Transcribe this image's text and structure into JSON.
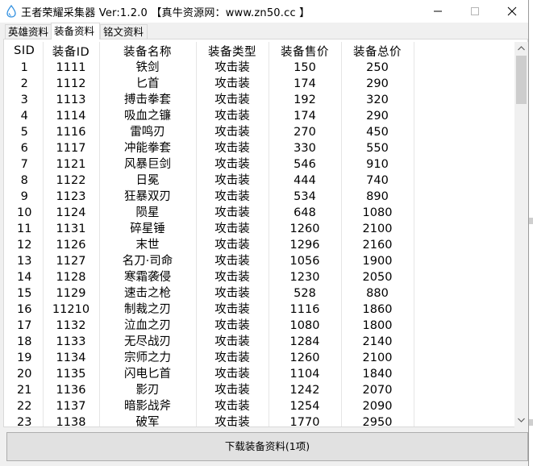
{
  "window": {
    "title": "王者荣耀采集器 Ver:1.2.0   【真牛资源网：www.zn50.cc 】"
  },
  "tabs": [
    {
      "label": "英雄资料",
      "active": false
    },
    {
      "label": "装备资料",
      "active": true
    },
    {
      "label": "铭文资料",
      "active": false
    }
  ],
  "table": {
    "columns": [
      "SID",
      "装备ID",
      "装备名称",
      "装备类型",
      "装备售价",
      "装备总价"
    ],
    "rows": [
      [
        "1",
        "1111",
        "铁剑",
        "攻击装",
        "150",
        "250"
      ],
      [
        "2",
        "1112",
        "匕首",
        "攻击装",
        "174",
        "290"
      ],
      [
        "3",
        "1113",
        "搏击拳套",
        "攻击装",
        "192",
        "320"
      ],
      [
        "4",
        "1114",
        "吸血之镰",
        "攻击装",
        "174",
        "290"
      ],
      [
        "5",
        "1116",
        "雷鸣刃",
        "攻击装",
        "270",
        "450"
      ],
      [
        "6",
        "1117",
        "冲能拳套",
        "攻击装",
        "330",
        "550"
      ],
      [
        "7",
        "1121",
        "风暴巨剑",
        "攻击装",
        "546",
        "910"
      ],
      [
        "8",
        "1122",
        "日冕",
        "攻击装",
        "444",
        "740"
      ],
      [
        "9",
        "1123",
        "狂暴双刃",
        "攻击装",
        "534",
        "890"
      ],
      [
        "10",
        "1124",
        "陨星",
        "攻击装",
        "648",
        "1080"
      ],
      [
        "11",
        "1131",
        "碎星锤",
        "攻击装",
        "1260",
        "2100"
      ],
      [
        "12",
        "1126",
        "末世",
        "攻击装",
        "1296",
        "2160"
      ],
      [
        "13",
        "1127",
        "名刀·司命",
        "攻击装",
        "1056",
        "1900"
      ],
      [
        "14",
        "1128",
        "寒霜袭侵",
        "攻击装",
        "1230",
        "2050"
      ],
      [
        "15",
        "1129",
        "速击之枪",
        "攻击装",
        "528",
        "880"
      ],
      [
        "16",
        "11210",
        "制裁之刃",
        "攻击装",
        "1116",
        "1860"
      ],
      [
        "17",
        "1132",
        "泣血之刃",
        "攻击装",
        "1080",
        "1800"
      ],
      [
        "18",
        "1133",
        "无尽战刃",
        "攻击装",
        "1284",
        "2140"
      ],
      [
        "19",
        "1134",
        "宗师之力",
        "攻击装",
        "1260",
        "2100"
      ],
      [
        "20",
        "1135",
        "闪电匕首",
        "攻击装",
        "1104",
        "1840"
      ],
      [
        "21",
        "1136",
        "影刃",
        "攻击装",
        "1242",
        "2070"
      ],
      [
        "22",
        "1137",
        "暗影战斧",
        "攻击装",
        "1254",
        "2090"
      ],
      [
        "23",
        "1138",
        "破军",
        "攻击装",
        "1770",
        "2950"
      ]
    ]
  },
  "download_button": {
    "label": "下载装备资料(1项)"
  },
  "colors": {
    "window_bg": "#f0f0f0",
    "grid_bg": "#ffffff",
    "button_bg": "#e1e1e1",
    "icon_blue": "#2f8fe0"
  },
  "icons": {
    "app": "water-drop-icon",
    "minimize": "minimize-icon",
    "maximize": "maximize-icon",
    "close": "close-icon"
  }
}
